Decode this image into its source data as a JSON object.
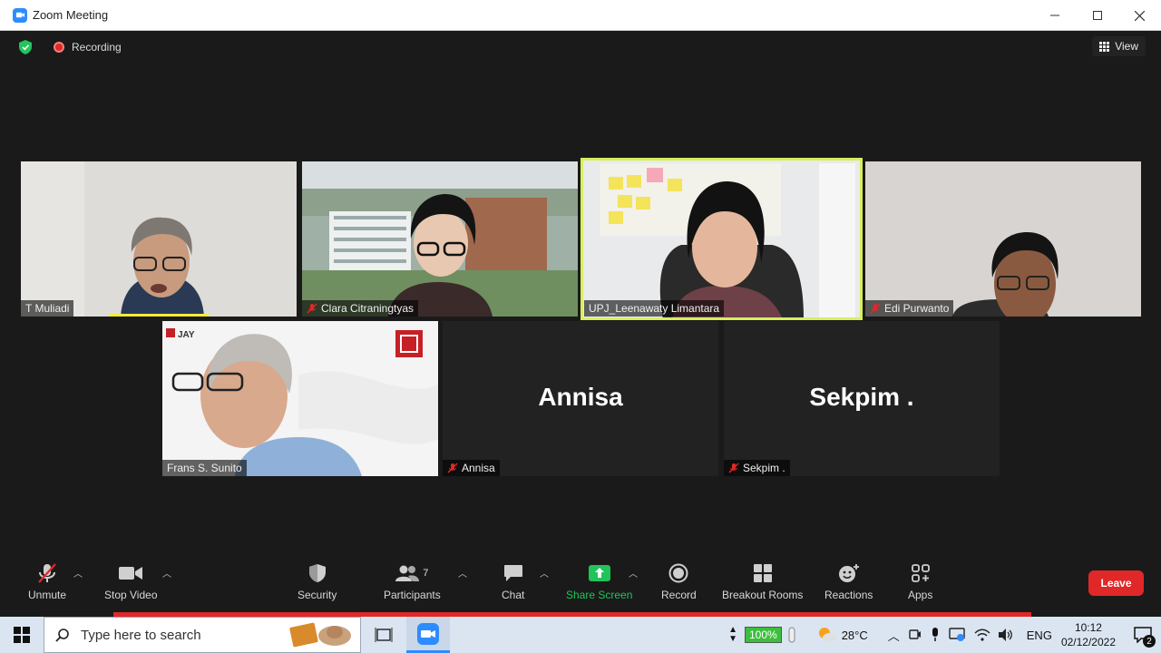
{
  "window": {
    "title": "Zoom Meeting"
  },
  "meeting": {
    "recording_label": "Recording",
    "view_label": "View"
  },
  "participants": [
    {
      "name": "T Muliadi",
      "muted": false
    },
    {
      "name": "Clara Citraningtyas",
      "muted": true
    },
    {
      "name": "UPJ_Leenawaty Limantara",
      "muted": false,
      "speaking": true
    },
    {
      "name": "Edi Purwanto",
      "muted": true
    },
    {
      "name": "Frans S. Sunito",
      "muted": false
    },
    {
      "name": "Annisa",
      "display": "Annisa",
      "muted": true,
      "video_off": true
    },
    {
      "name": "Sekpim .",
      "display": "Sekpim .",
      "muted": true,
      "video_off": true
    }
  ],
  "toolbar": {
    "unmute": "Unmute",
    "stop_video": "Stop Video",
    "security": "Security",
    "participants": "Participants",
    "participant_count": "7",
    "chat": "Chat",
    "share_screen": "Share Screen",
    "record": "Record",
    "breakout_rooms": "Breakout Rooms",
    "reactions": "Reactions",
    "apps": "Apps",
    "leave": "Leave"
  },
  "taskbar": {
    "search_placeholder": "Type here to search",
    "battery": "100%",
    "temperature": "28°C",
    "language": "ENG",
    "time": "10:12",
    "date": "02/12/2022",
    "notification_count": "2"
  },
  "colors": {
    "accent": "#2D8CFF",
    "leave": "#e02828",
    "share": "#21c35b",
    "speaker_outline": "#d7ef5e"
  }
}
